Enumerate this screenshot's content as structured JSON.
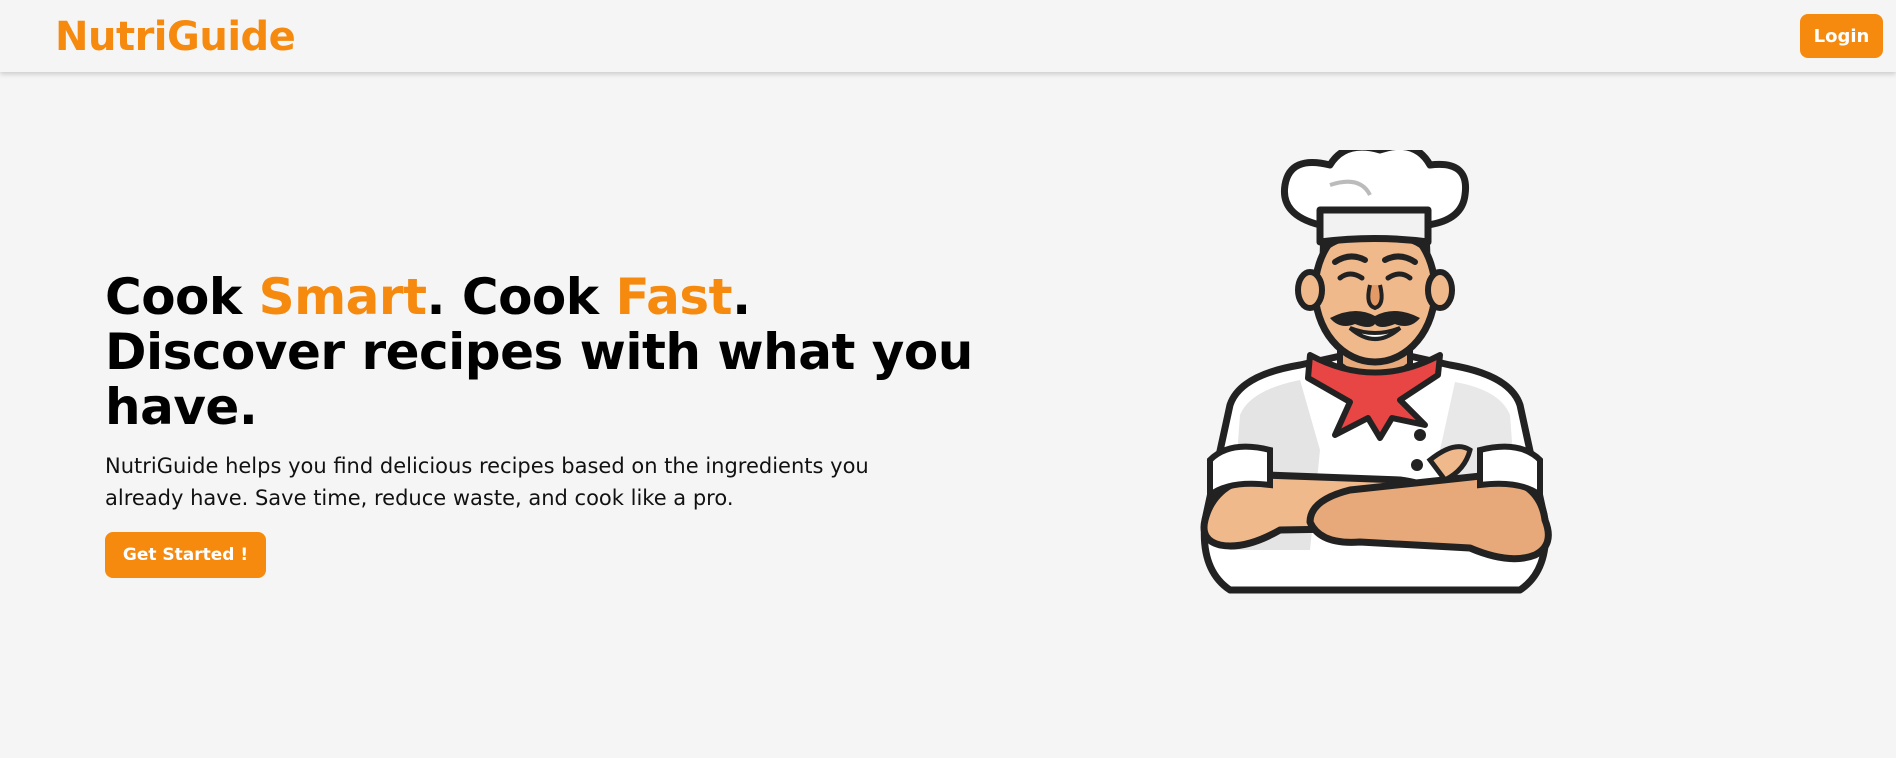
{
  "navbar": {
    "brand": "NutriGuide",
    "login_label": "Login"
  },
  "hero": {
    "headline": {
      "part1": "Cook ",
      "accent1": "Smart",
      "part2": ". Cook ",
      "accent2": "Fast",
      "part3": ". Discover recipes with what you have."
    },
    "description": "NutriGuide helps you find delicious recipes based on the ingredients you already have. Save time, reduce waste, and cook like a pro.",
    "cta_label": "Get Started !"
  },
  "illustration": {
    "icon": "chef-illustration"
  },
  "colors": {
    "accent": "#f58a0f",
    "background": "#f5f5f5",
    "text": "#000000"
  }
}
